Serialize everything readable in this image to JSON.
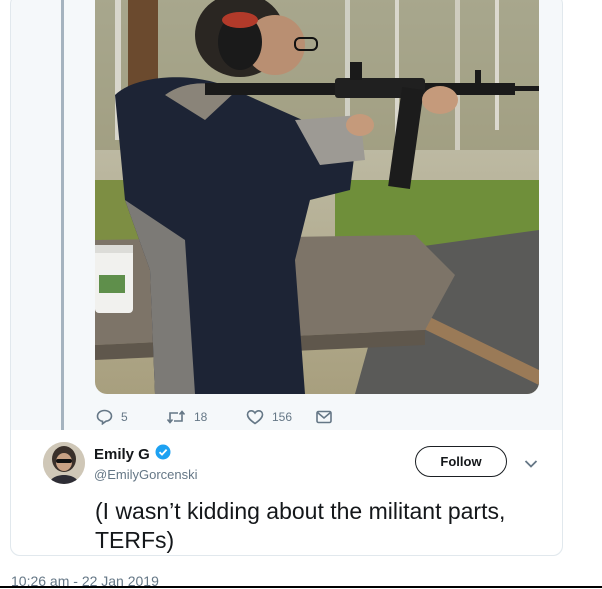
{
  "tweet_actions": {
    "replies": "5",
    "retweets": "18",
    "likes": "156"
  },
  "reply_tweet": {
    "display_name": "Emily G",
    "handle": "@EmilyGorcenski",
    "follow_label": "Follow",
    "text": "(I wasn’t kidding about the militant parts, TERFs)"
  },
  "timestamp": "10:26 am - 22 Jan 2019",
  "colors": {
    "verified": "#1da1f2",
    "muted": "#657786",
    "thread_line": "#a5b3bf"
  },
  "icons": [
    "reply-icon",
    "retweet-icon",
    "like-icon",
    "message-icon",
    "verified-badge-icon",
    "chevron-down-icon"
  ]
}
